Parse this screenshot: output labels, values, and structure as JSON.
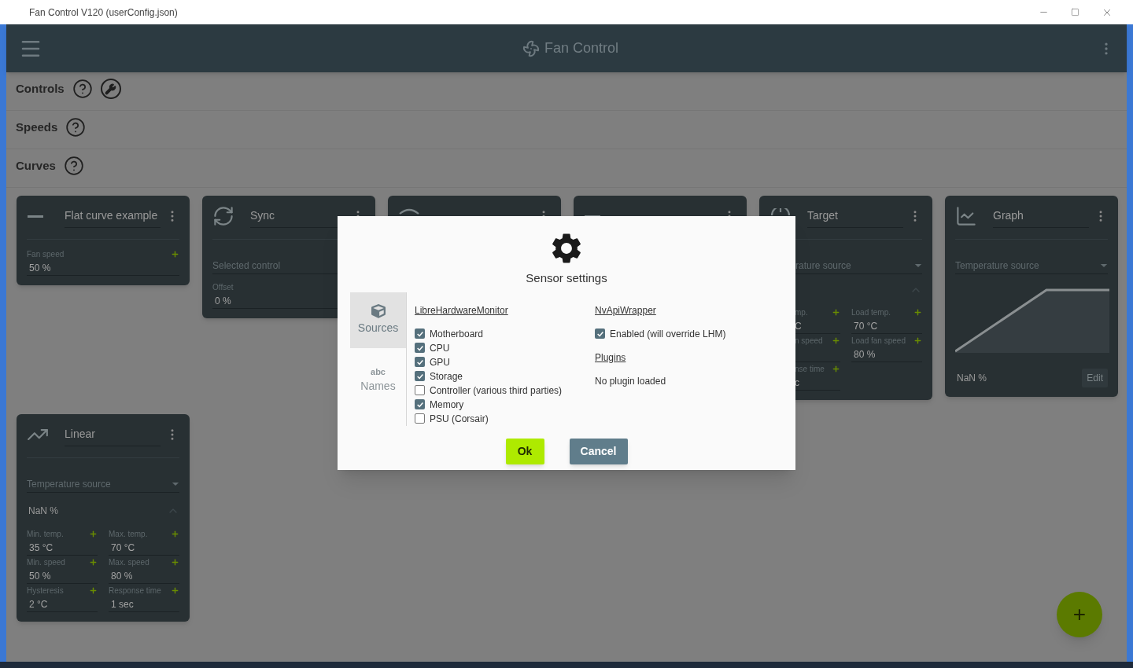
{
  "window": {
    "title": "Fan Control V120 (userConfig.json)"
  },
  "app_bar": {
    "title": "Fan Control"
  },
  "sections": [
    {
      "label": "Controls",
      "kind": "tools"
    },
    {
      "label": "Speeds",
      "kind": "plain"
    },
    {
      "label": "Curves",
      "kind": "plain"
    }
  ],
  "cards": [
    {
      "kind": "flat",
      "title": "Flat curve example",
      "fields": [
        {
          "label": "Fan speed",
          "value": "50 %"
        }
      ]
    },
    {
      "kind": "sync",
      "title": "Sync",
      "select": "Selected control",
      "fields": [
        {
          "label": "Offset",
          "value": "0 %"
        }
      ]
    },
    {
      "kind": "mix"
    },
    {
      "kind": "flat"
    },
    {
      "kind": "target",
      "title": "Target",
      "select": "rature source",
      "expanded": true,
      "fields": [
        {
          "label": "mp.",
          "value": "C"
        },
        {
          "label": "Load temp.",
          "value": "70 °C"
        },
        {
          "label": "n speed"
        },
        {
          "label": "Load fan speed",
          "value": "80 %"
        },
        {
          "label": "nse time",
          "value": "c"
        }
      ]
    },
    {
      "kind": "graph",
      "title": "Graph",
      "select": "Temperature source",
      "reading": "NaN %",
      "action": "Edit"
    },
    {
      "kind": "linear",
      "title": "Linear",
      "select": "Temperature source",
      "reading": "NaN %",
      "expanded": true,
      "fields": [
        {
          "label": "Min. temp.",
          "value": "35 °C"
        },
        {
          "label": "Max. temp.",
          "value": "70 °C"
        },
        {
          "label": "Min. speed",
          "value": "50 %"
        },
        {
          "label": "Max. speed",
          "value": "80 %"
        },
        {
          "label": "Hysteresis",
          "value": "2 °C"
        },
        {
          "label": "Response time",
          "value": "1 sec"
        }
      ]
    }
  ],
  "dialog": {
    "title": "Sensor settings",
    "nav": [
      {
        "label": "Sources",
        "kind": "sources",
        "selected": true
      },
      {
        "label": "Names",
        "kind": "names",
        "glyph": "abc",
        "selected": false
      }
    ],
    "columns": [
      {
        "blocks": [
          {
            "heading": "LibreHardwareMonitor",
            "options": [
              {
                "label": "Motherboard",
                "checked": true
              },
              {
                "label": "CPU",
                "checked": true
              },
              {
                "label": "GPU",
                "checked": true
              },
              {
                "label": "Storage",
                "checked": true
              },
              {
                "label": "Controller (various third parties)",
                "checked": false
              },
              {
                "label": "Memory",
                "checked": true
              },
              {
                "label": "PSU (Corsair)",
                "checked": false
              }
            ]
          }
        ]
      },
      {
        "blocks": [
          {
            "heading": "NvApiWrapper",
            "options": [
              {
                "label": "Enabled (will override LHM)",
                "checked": true
              }
            ]
          },
          {
            "heading": "Plugins",
            "note": "No plugin loaded"
          }
        ]
      }
    ],
    "buttons": [
      {
        "label": "Ok",
        "kind": "primary"
      },
      {
        "label": "Cancel",
        "kind": "secondary"
      }
    ]
  },
  "fab": {
    "label": "+"
  }
}
